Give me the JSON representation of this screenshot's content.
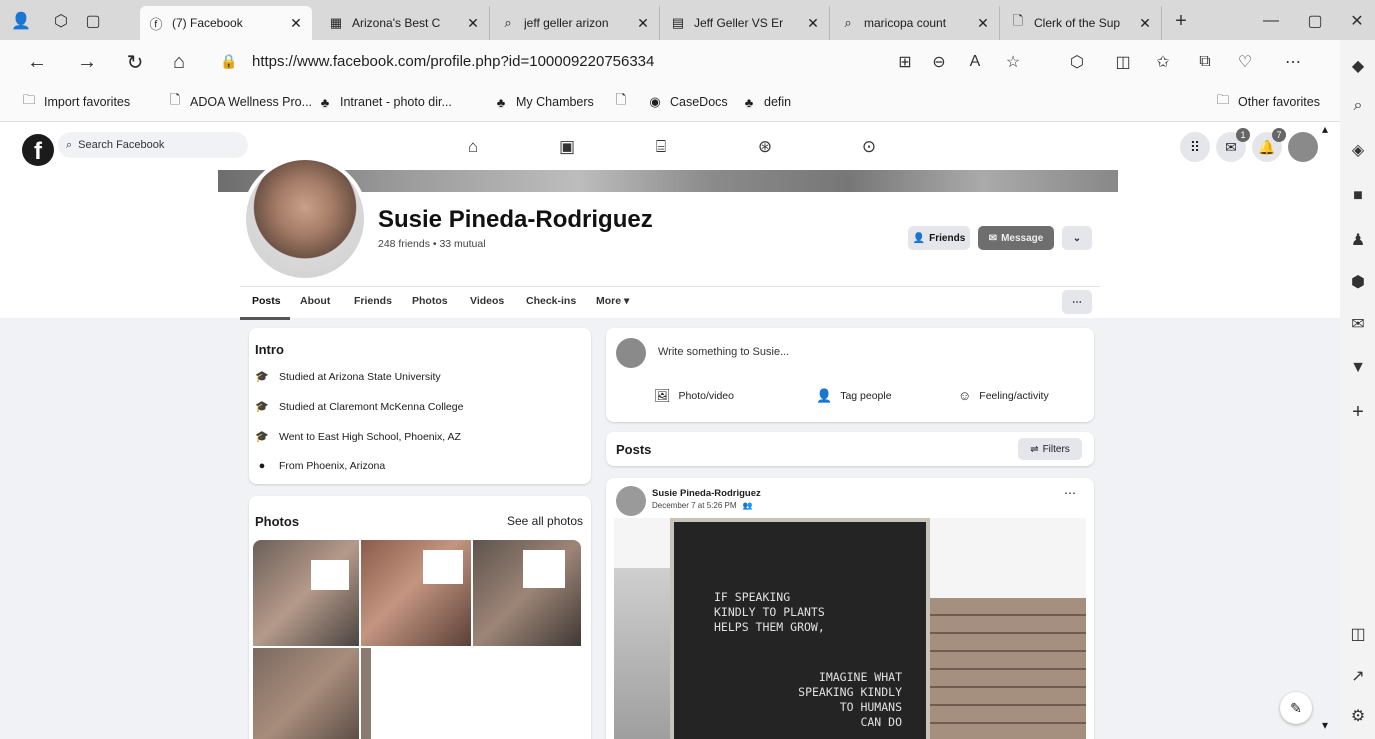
{
  "browser": {
    "tabs": [
      {
        "title": "(7) Facebook",
        "icon": "facebook-icon",
        "active": true
      },
      {
        "title": "Arizona's Best C",
        "icon": "site-icon"
      },
      {
        "title": "jeff geller arizon",
        "icon": "search-icon"
      },
      {
        "title": "Jeff Geller VS Er",
        "icon": "doc-icon"
      },
      {
        "title": "maricopa count",
        "icon": "search-icon"
      },
      {
        "title": "Clerk of the Sup",
        "icon": "page-icon"
      }
    ],
    "url": "https://www.facebook.com/profile.php?id=100009220756334",
    "favorites": [
      "Import favorites",
      "ADOA Wellness Pro...",
      "Intranet - photo dir...",
      "My Chambers",
      "CaseDocs",
      "defin"
    ],
    "other_favorites": "Other favorites"
  },
  "facebook": {
    "search_placeholder": "Search Facebook",
    "messenger_badge": "1",
    "notifications_badge": "7",
    "profile": {
      "name": "Susie Pineda-Rodriguez",
      "friends": "248 friends • 33 mutual",
      "friends_button": "Friends",
      "message_button": "Message",
      "tabs": [
        "Posts",
        "About",
        "Friends",
        "Photos",
        "Videos",
        "Check-ins",
        "More ▾"
      ]
    },
    "intro": {
      "title": "Intro",
      "items": [
        "Studied at Arizona State University",
        "Studied at Claremont McKenna College",
        "Went to East High School, Phoenix, AZ",
        "From Phoenix, Arizona"
      ]
    },
    "photos": {
      "title": "Photos",
      "see_all": "See all photos"
    },
    "composer": {
      "placeholder": "Write something to Susie...",
      "photo_video": "Photo/video",
      "tag_people": "Tag people",
      "feeling": "Feeling/activity"
    },
    "posts": {
      "title": "Posts",
      "filters": "Filters"
    },
    "post": {
      "author": "Susie Pineda-Rodriguez",
      "time": "December 7 at 5:26 PM",
      "sign_lines": [
        "IF SPEAKING",
        "KINDLY TO PLANTS",
        "HELPS THEM GROW,",
        "IMAGINE WHAT",
        "SPEAKING KINDLY",
        "TO HUMANS",
        "CAN DO"
      ]
    }
  }
}
